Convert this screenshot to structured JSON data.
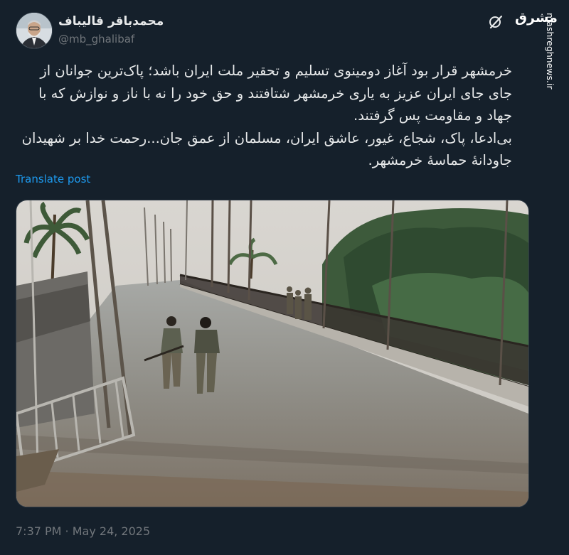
{
  "author": {
    "name": "محمدباقر قالیباف",
    "handle": "@mb_ghalibaf"
  },
  "header": {
    "icons": [
      "grok-icon"
    ],
    "watermark_logo": "مشرق",
    "watermark_site": "mashreghnews.ir"
  },
  "post": {
    "paragraph_1": "خرمشهر قرار بود آغاز دومینوی تسلیم و تحقیر ملت ایران باشد؛ پاک‌ترین جوانان از جای جای ایران عزیز به یاری خرمشهر شتافتند و حق خود را نه با ناز و نوازش که با جهاد و مقاومت پس گرفتند.",
    "paragraph_2": "بی‌ادعا، پاک، شجاع، غیور، عاشق ایران، مسلمان از عمق جان...رحمت خدا بر شهیدان جاودانهٔ حماسهٔ خرمشهر.",
    "translate_label": "Translate post"
  },
  "media": {
    "type": "photo"
  },
  "meta": {
    "timestamp": "7:37 PM · May 24, 2025"
  },
  "colors": {
    "background": "#15202b",
    "text": "#e7e9ea",
    "secondary": "#71767b",
    "link": "#1d9bf0"
  }
}
